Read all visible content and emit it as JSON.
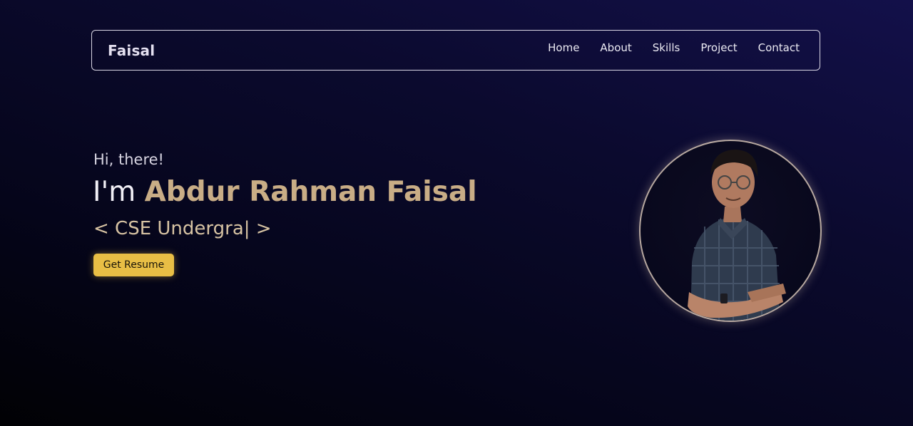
{
  "navbar": {
    "brand": "Faisal",
    "links": [
      "Home",
      "About",
      "Skills",
      "Project",
      "Contact"
    ]
  },
  "hero": {
    "greeting": "Hi, there!",
    "intro_prefix": "I'm",
    "name": "Abdur Rahman Faisal",
    "role_text": "< CSE Undergra| >",
    "resume_button": "Get Resume"
  },
  "avatar": {
    "icon": "profile-photo"
  },
  "colors": {
    "accent_name": "#c9ad86",
    "button": "#e8be45",
    "background_dark": "#010104",
    "background_light": "#13104a"
  }
}
